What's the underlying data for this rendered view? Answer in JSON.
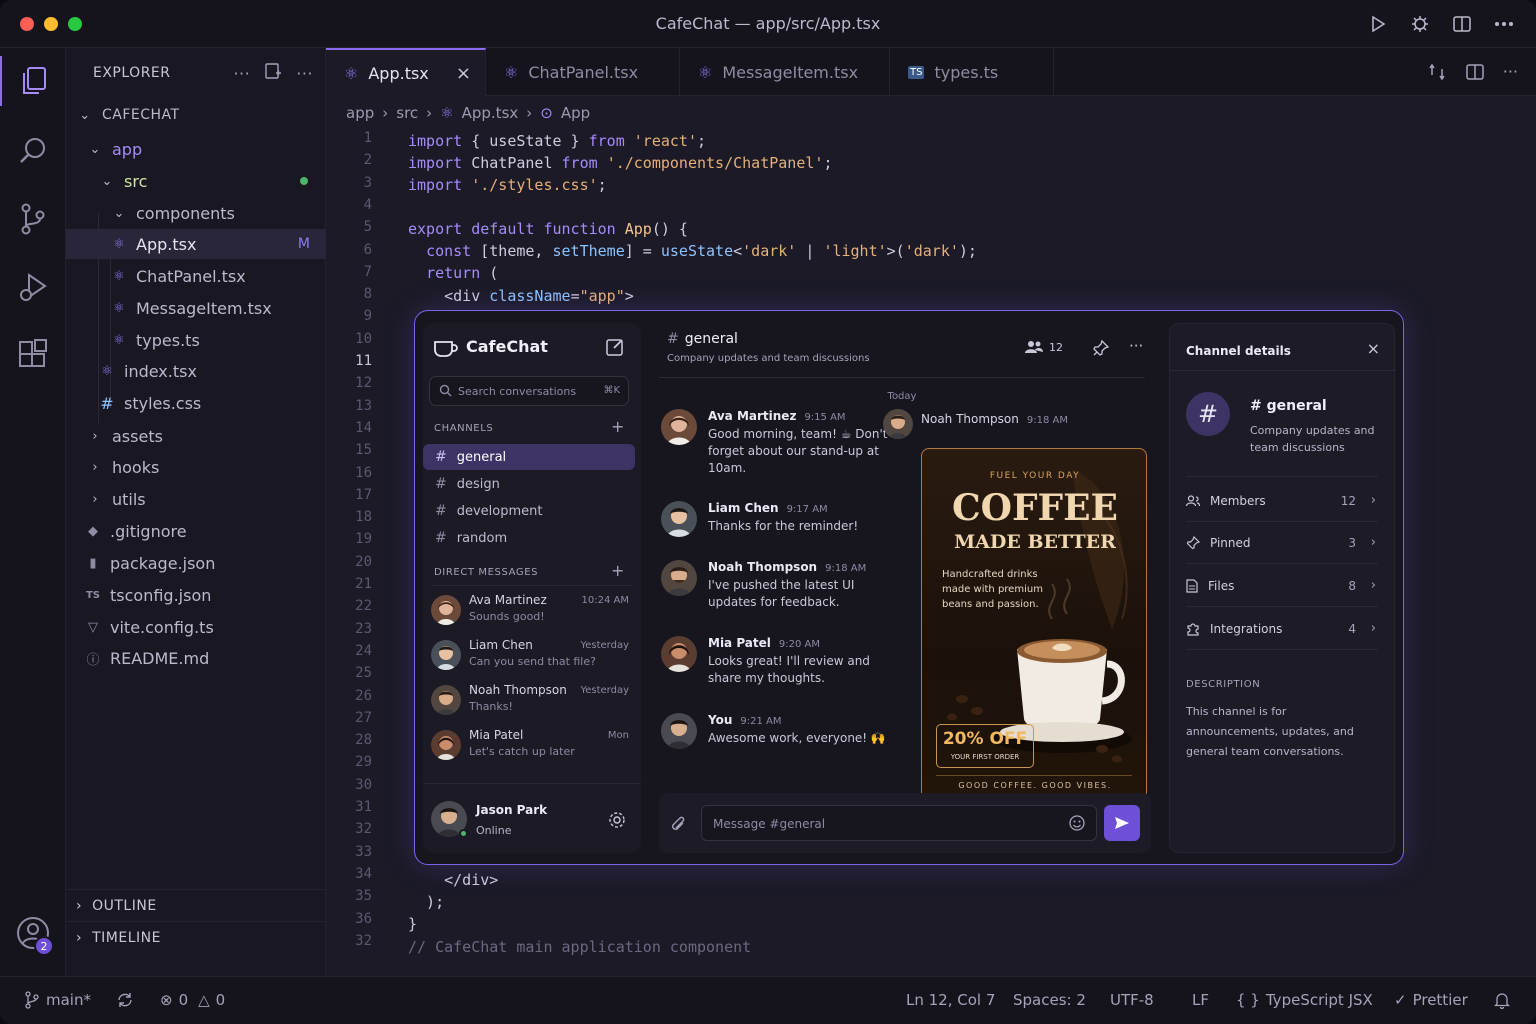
{
  "window": {
    "title": "CafeChat — app/src/App.tsx"
  },
  "colors": {
    "accent": "#8b6cf0",
    "bg": "#16151f",
    "close": "#ff5f57",
    "minimize": "#febc2e",
    "zoom": "#28c840",
    "git_added": "#4fb36b"
  },
  "explorer": {
    "title": "EXPLORER",
    "project": "CAFECHAT",
    "tree": [
      {
        "label": "app",
        "icon": "chevron-down-icon"
      },
      {
        "label": "src",
        "icon": "chevron-down-icon"
      },
      {
        "label": "components",
        "icon": "chevron-down-icon"
      },
      {
        "label": "App.tsx",
        "icon": "react-icon",
        "status": "M"
      },
      {
        "label": "ChatPanel.tsx",
        "icon": "react-icon"
      },
      {
        "label": "MessageItem.tsx",
        "icon": "react-icon"
      },
      {
        "label": "types.ts",
        "icon": "react-icon"
      },
      {
        "label": "index.tsx",
        "icon": "react-icon"
      },
      {
        "label": "styles.css",
        "icon": "hash-icon"
      },
      {
        "label": "assets",
        "icon": "chevron-right-icon"
      },
      {
        "label": "hooks",
        "icon": "chevron-right-icon"
      },
      {
        "label": "utils",
        "icon": "chevron-right-icon"
      },
      {
        "label": ".gitignore",
        "icon": "git-icon"
      },
      {
        "label": "package.json",
        "icon": "npm-icon"
      },
      {
        "label": "tsconfig.json",
        "icon": "ts-icon"
      },
      {
        "label": "vite.config.ts",
        "icon": "vite-icon"
      },
      {
        "label": "README.md",
        "icon": "info-icon"
      }
    ],
    "outline": "OUTLINE",
    "timeline": "TIMELINE",
    "accounts_badge": "2"
  },
  "tabs": [
    {
      "label": "App.tsx",
      "active": true
    },
    {
      "label": "ChatPanel.tsx"
    },
    {
      "label": "MessageItem.tsx"
    },
    {
      "label": "types.ts"
    }
  ],
  "breadcrumb": [
    "app",
    "src",
    "App.tsx",
    "App"
  ],
  "editor": {
    "line_numbers": [
      "1",
      "2",
      "3",
      "4",
      "5",
      "6",
      "7",
      "8",
      "9",
      "10",
      "11",
      "12",
      "13",
      "14",
      "15",
      "16",
      "17",
      "18",
      "19",
      "20",
      "21",
      "22",
      "23",
      "24",
      "25",
      "26",
      "27",
      "28",
      "29",
      "30",
      "31",
      "32",
      "33",
      "34",
      "35",
      "36",
      "32"
    ],
    "current_line": "11",
    "closing_lines": [
      "    </div>",
      "  );",
      "}",
      "// CafeChat main application component"
    ]
  },
  "chat": {
    "app_name": "CafeChat",
    "search_placeholder": "Search conversations",
    "search_shortcut": "⌘K",
    "channels_label": "CHANNELS",
    "channels": [
      "general",
      "design",
      "development",
      "random"
    ],
    "dm_label": "DIRECT MESSAGES",
    "dms": [
      {
        "name": "Ava Martinez",
        "preview": "Sounds good!",
        "time": "10:24 AM"
      },
      {
        "name": "Liam Chen",
        "preview": "Can you send that file?",
        "time": "Yesterday"
      },
      {
        "name": "Noah Thompson",
        "preview": "Thanks!",
        "time": "Yesterday"
      },
      {
        "name": "Mia Patel",
        "preview": "Let's catch up later",
        "time": "Mon"
      }
    ],
    "user": {
      "name": "Jason Park",
      "status": "Online"
    },
    "channel": {
      "name": "general",
      "description": "Company updates and team discussions",
      "members": "12"
    },
    "day_divider": "Today",
    "messages": [
      {
        "author": "Ava Martinez",
        "time": "9:15 AM",
        "text": "Good morning, team! ☕ Don't forget about our stand-up at 10am."
      },
      {
        "author": "Liam Chen",
        "time": "9:17 AM",
        "text": "Thanks for the reminder!"
      },
      {
        "author": "Noah Thompson",
        "time": "9:18 AM",
        "text": "I've pushed the latest UI updates for feedback."
      },
      {
        "author": "Mia Patel",
        "time": "9:20 AM",
        "text": "Looks great! I'll review and share my thoughts."
      },
      {
        "author": "You",
        "time": "9:21 AM",
        "text": "Awesome work, everyone! 🙌"
      }
    ],
    "image_post": {
      "author": "Noah Thompson",
      "time": "9:18 AM"
    },
    "poster": {
      "kicker": "FUEL YOUR DAY",
      "title": "COFFEE",
      "subtitle": "MADE BETTER",
      "body": "Handcrafted drinks made with premium beans and passion.",
      "offer": "20% OFF",
      "offer_sub": "YOUR FIRST ORDER",
      "footer": "GOOD COFFEE. GOOD VIBES."
    },
    "composer_placeholder": "Message #general",
    "details": {
      "title": "Channel details",
      "channel_name": "# general",
      "channel_desc": "Company updates and team discussions",
      "rows": [
        {
          "label": "Members",
          "count": "12"
        },
        {
          "label": "Pinned",
          "count": "3"
        },
        {
          "label": "Files",
          "count": "8"
        },
        {
          "label": "Integrations",
          "count": "4"
        }
      ],
      "description_label": "DESCRIPTION",
      "description": "This channel is for announcements, updates, and general team conversations."
    }
  },
  "status": {
    "branch": "main*",
    "errors": "0",
    "warnings": "0",
    "position": "Ln 12, Col 7",
    "spaces": "Spaces: 2",
    "encoding": "UTF-8",
    "eol": "LF",
    "language": "TypeScript JSX",
    "formatter": "Prettier"
  }
}
